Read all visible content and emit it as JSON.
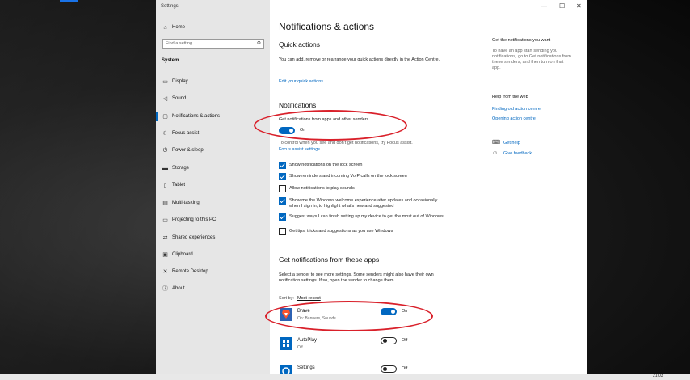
{
  "window": {
    "title": "Settings",
    "minimize": "—",
    "maximize": "☐",
    "close": "✕"
  },
  "sidebar": {
    "home": "Home",
    "search_placeholder": "Find a setting",
    "section": "System",
    "items": [
      {
        "label": "Display",
        "icon": "display-icon"
      },
      {
        "label": "Sound",
        "icon": "sound-icon"
      },
      {
        "label": "Notifications & actions",
        "icon": "notifications-icon"
      },
      {
        "label": "Focus assist",
        "icon": "focus-assist-icon"
      },
      {
        "label": "Power & sleep",
        "icon": "power-icon"
      },
      {
        "label": "Storage",
        "icon": "storage-icon"
      },
      {
        "label": "Tablet",
        "icon": "tablet-icon"
      },
      {
        "label": "Multi-tasking",
        "icon": "multitasking-icon"
      },
      {
        "label": "Projecting to this PC",
        "icon": "projecting-icon"
      },
      {
        "label": "Shared experiences",
        "icon": "shared-icon"
      },
      {
        "label": "Clipboard",
        "icon": "clipboard-icon"
      },
      {
        "label": "Remote Desktop",
        "icon": "remote-desktop-icon"
      },
      {
        "label": "About",
        "icon": "about-icon"
      }
    ]
  },
  "main": {
    "title": "Notifications & actions",
    "quick_actions": {
      "heading": "Quick actions",
      "desc": "You can add, remove or rearrange your quick actions directly in the Action Centre.",
      "link": "Edit your quick actions"
    },
    "notifications": {
      "heading": "Notifications",
      "get_label": "Get notifications from apps and other senders",
      "toggle_state": "On",
      "focus_text": "To control when you see and don't get notifications, try Focus assist.",
      "focus_link": "Focus assist settings",
      "checkboxes": [
        {
          "label": "Show notifications on the lock screen",
          "checked": true
        },
        {
          "label": "Show reminders and incoming VoIP calls on the lock screen",
          "checked": true
        },
        {
          "label": "Allow notifications to play sounds",
          "checked": false
        },
        {
          "label": "Show me the Windows welcome experience after updates and occasionally when I sign in, to highlight what's new and suggested",
          "checked": true
        },
        {
          "label": "Suggest ways I can finish setting up my device to get the most out of Windows",
          "checked": true
        },
        {
          "label": "Get tips, tricks and suggestions as you use Windows",
          "checked": false
        }
      ]
    },
    "senders": {
      "heading": "Get notifications from these apps",
      "desc": "Select a sender to see more settings. Some senders might also have their own notification settings. If so, open the sender to change them.",
      "sort_label": "Sort by:",
      "sort_value": "Most recent",
      "apps": [
        {
          "name": "Brave",
          "sub": "On: Banners, Sounds",
          "state": "On",
          "icon": "brave-icon",
          "color": "#fb542b"
        },
        {
          "name": "AutoPlay",
          "sub": "Off",
          "state": "Off",
          "icon": "autoplay-icon",
          "color": "#0067c0"
        },
        {
          "name": "Settings",
          "sub": "",
          "state": "Off",
          "icon": "settings-icon",
          "color": "#0067c0"
        }
      ]
    }
  },
  "right": {
    "help_heading": "Get the notifications you want",
    "help_text": "To have an app start sending you notifications, go to Get notifications from these senders, and then turn on that app.",
    "web_heading": "Help from the web",
    "web_links": [
      "Finding old action centre",
      "Opening action centre"
    ],
    "get_help": "Get help",
    "give_feedback": "Give feedback"
  },
  "taskbar": {
    "time": "21:03"
  }
}
